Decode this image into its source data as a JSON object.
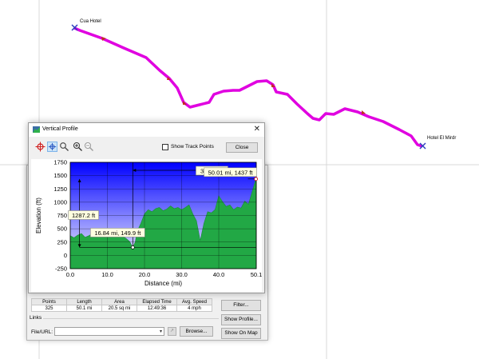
{
  "map": {
    "start_label": "Cua Hotel",
    "end_label": "Hotel El Mirdr",
    "track_color": "#e000e0"
  },
  "properties": {
    "stats_headers": [
      "Points",
      "Length",
      "Area",
      "Elapsed Time",
      "Avg. Speed"
    ],
    "stats_values": [
      "325",
      "50.1 mi",
      "20.5 sq mi",
      "12:49:36",
      "4 mph"
    ],
    "filter_label": "Filter...",
    "show_profile_label": "Show Profile...",
    "show_on_map_label": "Show On Map",
    "links_title": "Links",
    "file_label": "File/URL:",
    "file_value": "",
    "browse_label": "Browse..."
  },
  "profile": {
    "title": "Vertical Profile",
    "show_track_points_label": "Show Track Points",
    "close_label": "Close",
    "icons": [
      "add-point-icon",
      "crosshair-icon",
      "select-zoom-icon",
      "zoom-in-icon",
      "zoom-out-icon"
    ]
  },
  "chart_data": {
    "type": "area",
    "xlabel": "Distance  (mi)",
    "ylabel": "Elevation (ft)",
    "xlim": [
      0,
      50.1
    ],
    "ylim": [
      -250,
      1750
    ],
    "x_ticks": [
      "0.0",
      "10.0",
      "20.0",
      "30.0",
      "40.0",
      "50.1"
    ],
    "y_ticks": [
      "1750",
      "1500",
      "1250",
      "1000",
      "750",
      "500",
      "250",
      "0",
      "-250"
    ],
    "background_gradient": [
      "#0000ff",
      "#ffffff"
    ],
    "fill_color": "#22a845",
    "grid": true,
    "series": [
      {
        "x": [
          0,
          1,
          2,
          3,
          4,
          5,
          6,
          7,
          8,
          9,
          10,
          11,
          12,
          13,
          14,
          15,
          16,
          16.84,
          17.5,
          18,
          19,
          20,
          21,
          22,
          23,
          24,
          25,
          26,
          27,
          28,
          29,
          30,
          31,
          32,
          33,
          34,
          35,
          36,
          37,
          38,
          39,
          40,
          41,
          42,
          43,
          44,
          45,
          46,
          47,
          48,
          49,
          50.01,
          50.1
        ],
        "y": [
          370,
          330,
          380,
          410,
          340,
          370,
          410,
          350,
          380,
          420,
          360,
          390,
          420,
          380,
          360,
          320,
          260,
          149.9,
          250,
          450,
          600,
          780,
          860,
          820,
          880,
          900,
          840,
          870,
          930,
          880,
          900,
          860,
          900,
          950,
          780,
          650,
          280,
          600,
          820,
          800,
          860,
          1120,
          1010,
          920,
          950,
          860,
          910,
          890,
          1020,
          960,
          1200,
          1437,
          1460
        ]
      }
    ],
    "annotations": [
      {
        "text": "33.17 mi",
        "from_x": 16.84,
        "to_x": 50.01,
        "y": 1600
      },
      {
        "text": "1287.2 ft",
        "x": 2.5,
        "from_y": 149.9,
        "to_y": 1437
      },
      {
        "text": "16.84 mi, 149.9 ft",
        "x": 16.84,
        "y": 149.9
      },
      {
        "text": "50.01 mi, 1437 ft",
        "x": 50.01,
        "y": 1437
      }
    ]
  }
}
